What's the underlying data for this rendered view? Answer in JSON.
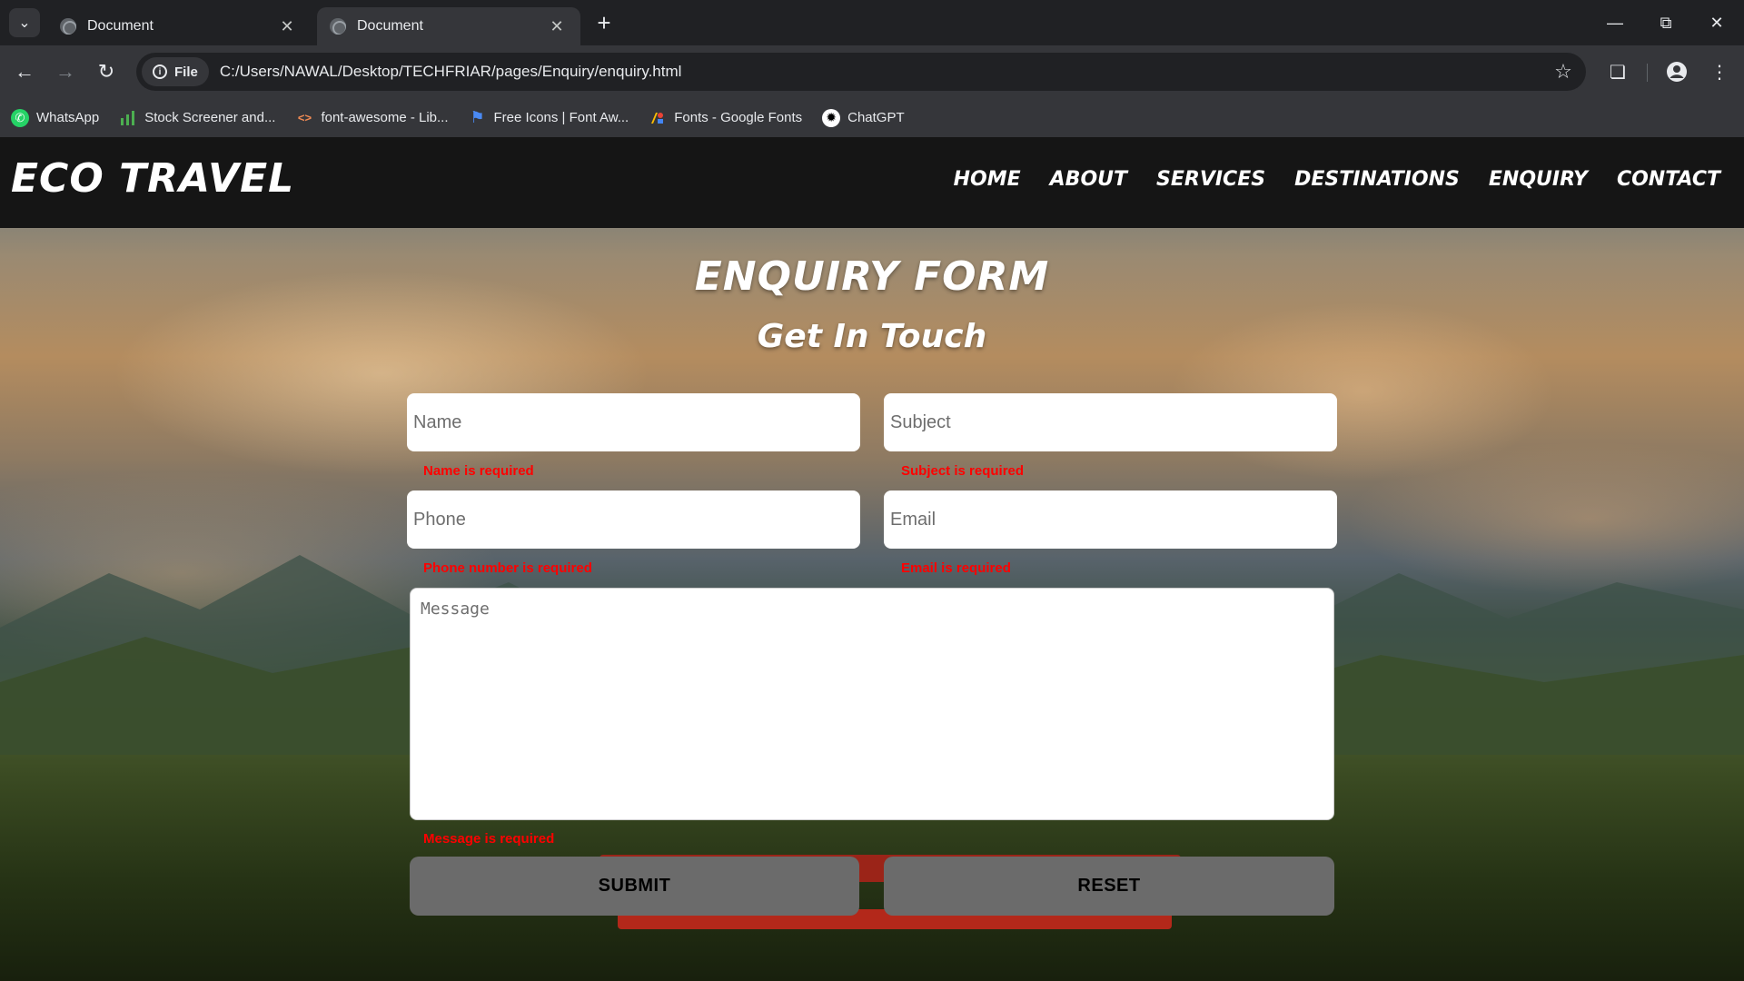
{
  "browser": {
    "tabs": [
      {
        "title": "Document",
        "active": false
      },
      {
        "title": "Document",
        "active": true
      }
    ],
    "new_tab": "+",
    "address_chip": "File",
    "url": "C:/Users/NAWAL/Desktop/TECHFRIAR/pages/Enquiry/enquiry.html",
    "bookmarks": [
      {
        "label": "WhatsApp",
        "icon": "whatsapp-icon",
        "color": "#25d366"
      },
      {
        "label": "Stock Screener and...",
        "icon": "bar-chart-icon",
        "color": "#4caf50"
      },
      {
        "label": "font-awesome - Lib...",
        "icon": "code-icon",
        "color": "#f28b54"
      },
      {
        "label": "Free Icons | Font Aw...",
        "icon": "flag-icon",
        "color": "#4a8af4"
      },
      {
        "label": "Fonts - Google Fonts",
        "icon": "google-fonts-icon",
        "color": "#ea4335"
      },
      {
        "label": "ChatGPT",
        "icon": "chatgpt-icon",
        "color": "#ffffff"
      }
    ]
  },
  "site": {
    "logo": "ECO TRAVEL",
    "nav": [
      "HOME",
      "ABOUT",
      "SERVICES",
      "DESTINATIONS",
      "ENQUIRY",
      "CONTACT"
    ]
  },
  "form": {
    "title": "ENQUIRY FORM",
    "subtitle": "Get In Touch",
    "name_placeholder": "Name",
    "subject_placeholder": "Subject",
    "phone_placeholder": "Phone",
    "email_placeholder": "Email",
    "message_placeholder": "Message",
    "errors": {
      "name": "Name is required",
      "subject": "Subject is required",
      "phone": "Phone number is required",
      "email": "Email is required",
      "message": "Message is required"
    },
    "submit_label": "SUBMIT",
    "reset_label": "RESET"
  }
}
